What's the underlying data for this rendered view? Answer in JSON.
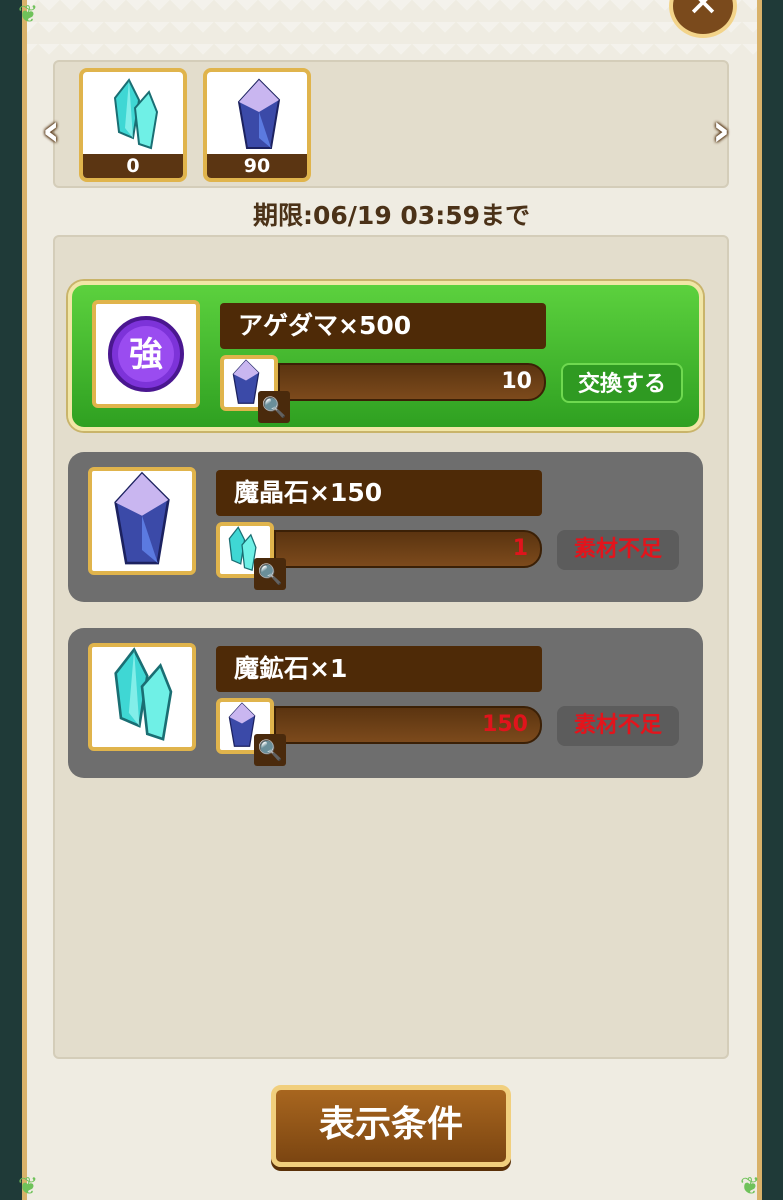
{
  "header": {
    "close_label": "✕"
  },
  "items": [
    {
      "icon": "cyan-crystal-icon",
      "count": "0"
    },
    {
      "icon": "purple-crystal-icon",
      "count": "90"
    }
  ],
  "nav": {
    "prev": "‹",
    "next": "›"
  },
  "deadline": "期限:06/19 03:59まで",
  "exchanges": [
    {
      "title": "アゲダマ×500",
      "reward_icon": "strengthen-orb-icon",
      "cost_icon": "purple-crystal-icon",
      "cost": "10",
      "status": "交換する",
      "available": true
    },
    {
      "title": "魔晶石×150",
      "reward_icon": "purple-crystal-icon",
      "cost_icon": "cyan-crystal-icon",
      "cost": "1",
      "status": "素材不足",
      "available": false
    },
    {
      "title": "魔鉱石×1",
      "reward_icon": "cyan-crystal-icon",
      "cost_icon": "purple-crystal-icon",
      "cost": "150",
      "status": "素材不足",
      "available": false
    }
  ],
  "footer": {
    "display_conditions": "表示条件"
  },
  "orb_label": "強",
  "colors": {
    "active_card": "#43b82e",
    "inactive_card": "#6e6e6e",
    "insufficient_text": "#e0141c",
    "frame_gold": "#e0b44c"
  }
}
